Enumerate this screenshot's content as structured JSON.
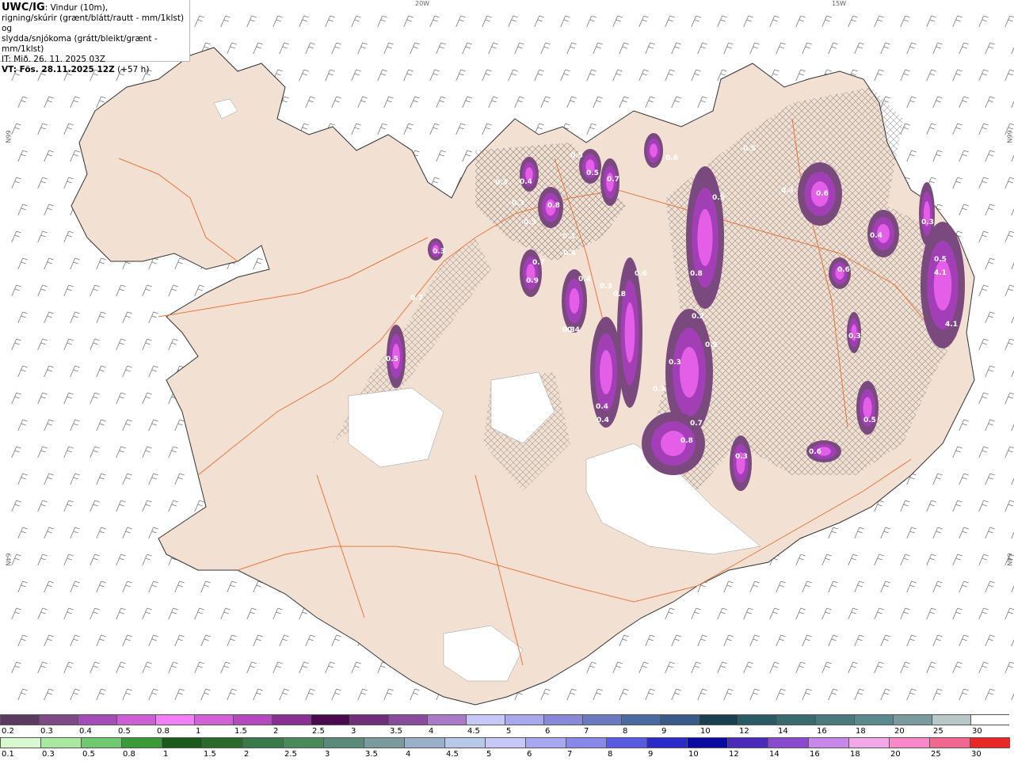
{
  "info": {
    "title": "UWC/IG",
    "title_suffix": ": Vindur (10m),",
    "line2": "rigning/skúrir (grænt/blátt/rautt - mm/1klst) og",
    "line3": "slydda/snjókoma (grátt/bleikt/grænt - mm/1klst)",
    "line4": "IT: Mið. 26. 11. 2025 03Z",
    "line5_bold": "VT: Fös. 28.11.2025 12Z",
    "line5_rest": " (+57 h)"
  },
  "axis_labels": {
    "top_left": "20W",
    "top_right": "15W",
    "left_upper": "66N",
    "left_lower": "64N",
    "right_upper": "66N",
    "right_lower": "64N"
  },
  "map_values": [
    "0.5",
    "0.5",
    "0.7",
    "0.4",
    "0.3",
    "0.3",
    "0.8",
    "0.5",
    "0.3",
    "0.4",
    "0.3",
    "0.7",
    "0.9",
    "0.4",
    "0.3",
    "0.6",
    "0.8",
    "0.9",
    "0.6",
    "0.3",
    "0.6",
    "0.5",
    "0.4",
    "0.6",
    "0.8",
    "0.2",
    "0.9",
    "0.3",
    "0.4",
    "0.4",
    "0.3",
    "0.7",
    "0.8",
    "0.3",
    "0.3",
    "0.6",
    "0.5",
    "0.4",
    "0.3",
    "0.5",
    "4.1",
    "4.1",
    "0.7",
    "0.3",
    "0.5"
  ],
  "colors": {
    "land": "#f2e1d3",
    "sea": "#ffffff",
    "roads": "#e8763c",
    "coast": "#333333",
    "snow_light": "#7a4a7e",
    "snow_mid": "#a23fb6",
    "snow_high": "#e45ee8"
  },
  "scale_top": {
    "labels": [
      "0.2",
      "0.3",
      "0.4",
      "0.5",
      "0.8",
      "1",
      "1.5",
      "2",
      "2.5",
      "3",
      "3.5",
      "4",
      "4.5",
      "5",
      "6",
      "7",
      "8",
      "9",
      "10",
      "12",
      "14",
      "16",
      "18",
      "20",
      "25",
      "30"
    ],
    "colors": [
      "#5a3a5e",
      "#7d4a86",
      "#a64cba",
      "#ce5ed6",
      "#f27ff5",
      "#d35fd9",
      "#b548bd",
      "#8a2f92",
      "#4a0a4e",
      "#6e2e7a",
      "#8a4a9e",
      "#a87ac8",
      "#c8c8f8",
      "#a8a8ec",
      "#8888d8",
      "#6c78c0",
      "#4a6aa0",
      "#3a5a8a",
      "#1a4050",
      "#2a5a64",
      "#386a70",
      "#4a7a80",
      "#5a8a90",
      "#7a9aa0",
      "#b8c8c8",
      "#ffffff"
    ]
  },
  "scale_bottom": {
    "labels": [
      "0.1",
      "0.3",
      "0.5",
      "0.8",
      "1",
      "1.5",
      "2",
      "2.5",
      "3",
      "3.5",
      "4",
      "4.5",
      "5",
      "6",
      "7",
      "8",
      "9",
      "10",
      "12",
      "14",
      "16",
      "18",
      "20",
      "25",
      "30"
    ],
    "colors": [
      "#d8f8d0",
      "#a8e8a0",
      "#70c870",
      "#3a9a3a",
      "#1a5a1a",
      "#2a6a2a",
      "#3a7a4a",
      "#4a8a5a",
      "#5a8a7a",
      "#7a9aa0",
      "#9ab0c8",
      "#b8c8e8",
      "#c8c8f8",
      "#a8a8f0",
      "#8888e8",
      "#5a5ae0",
      "#2a2ac8",
      "#0a0aa0",
      "#4a2ab8",
      "#8a4ad0",
      "#c888e8",
      "#f0a8e8",
      "#f888c8",
      "#f06890",
      "#e82828"
    ]
  }
}
